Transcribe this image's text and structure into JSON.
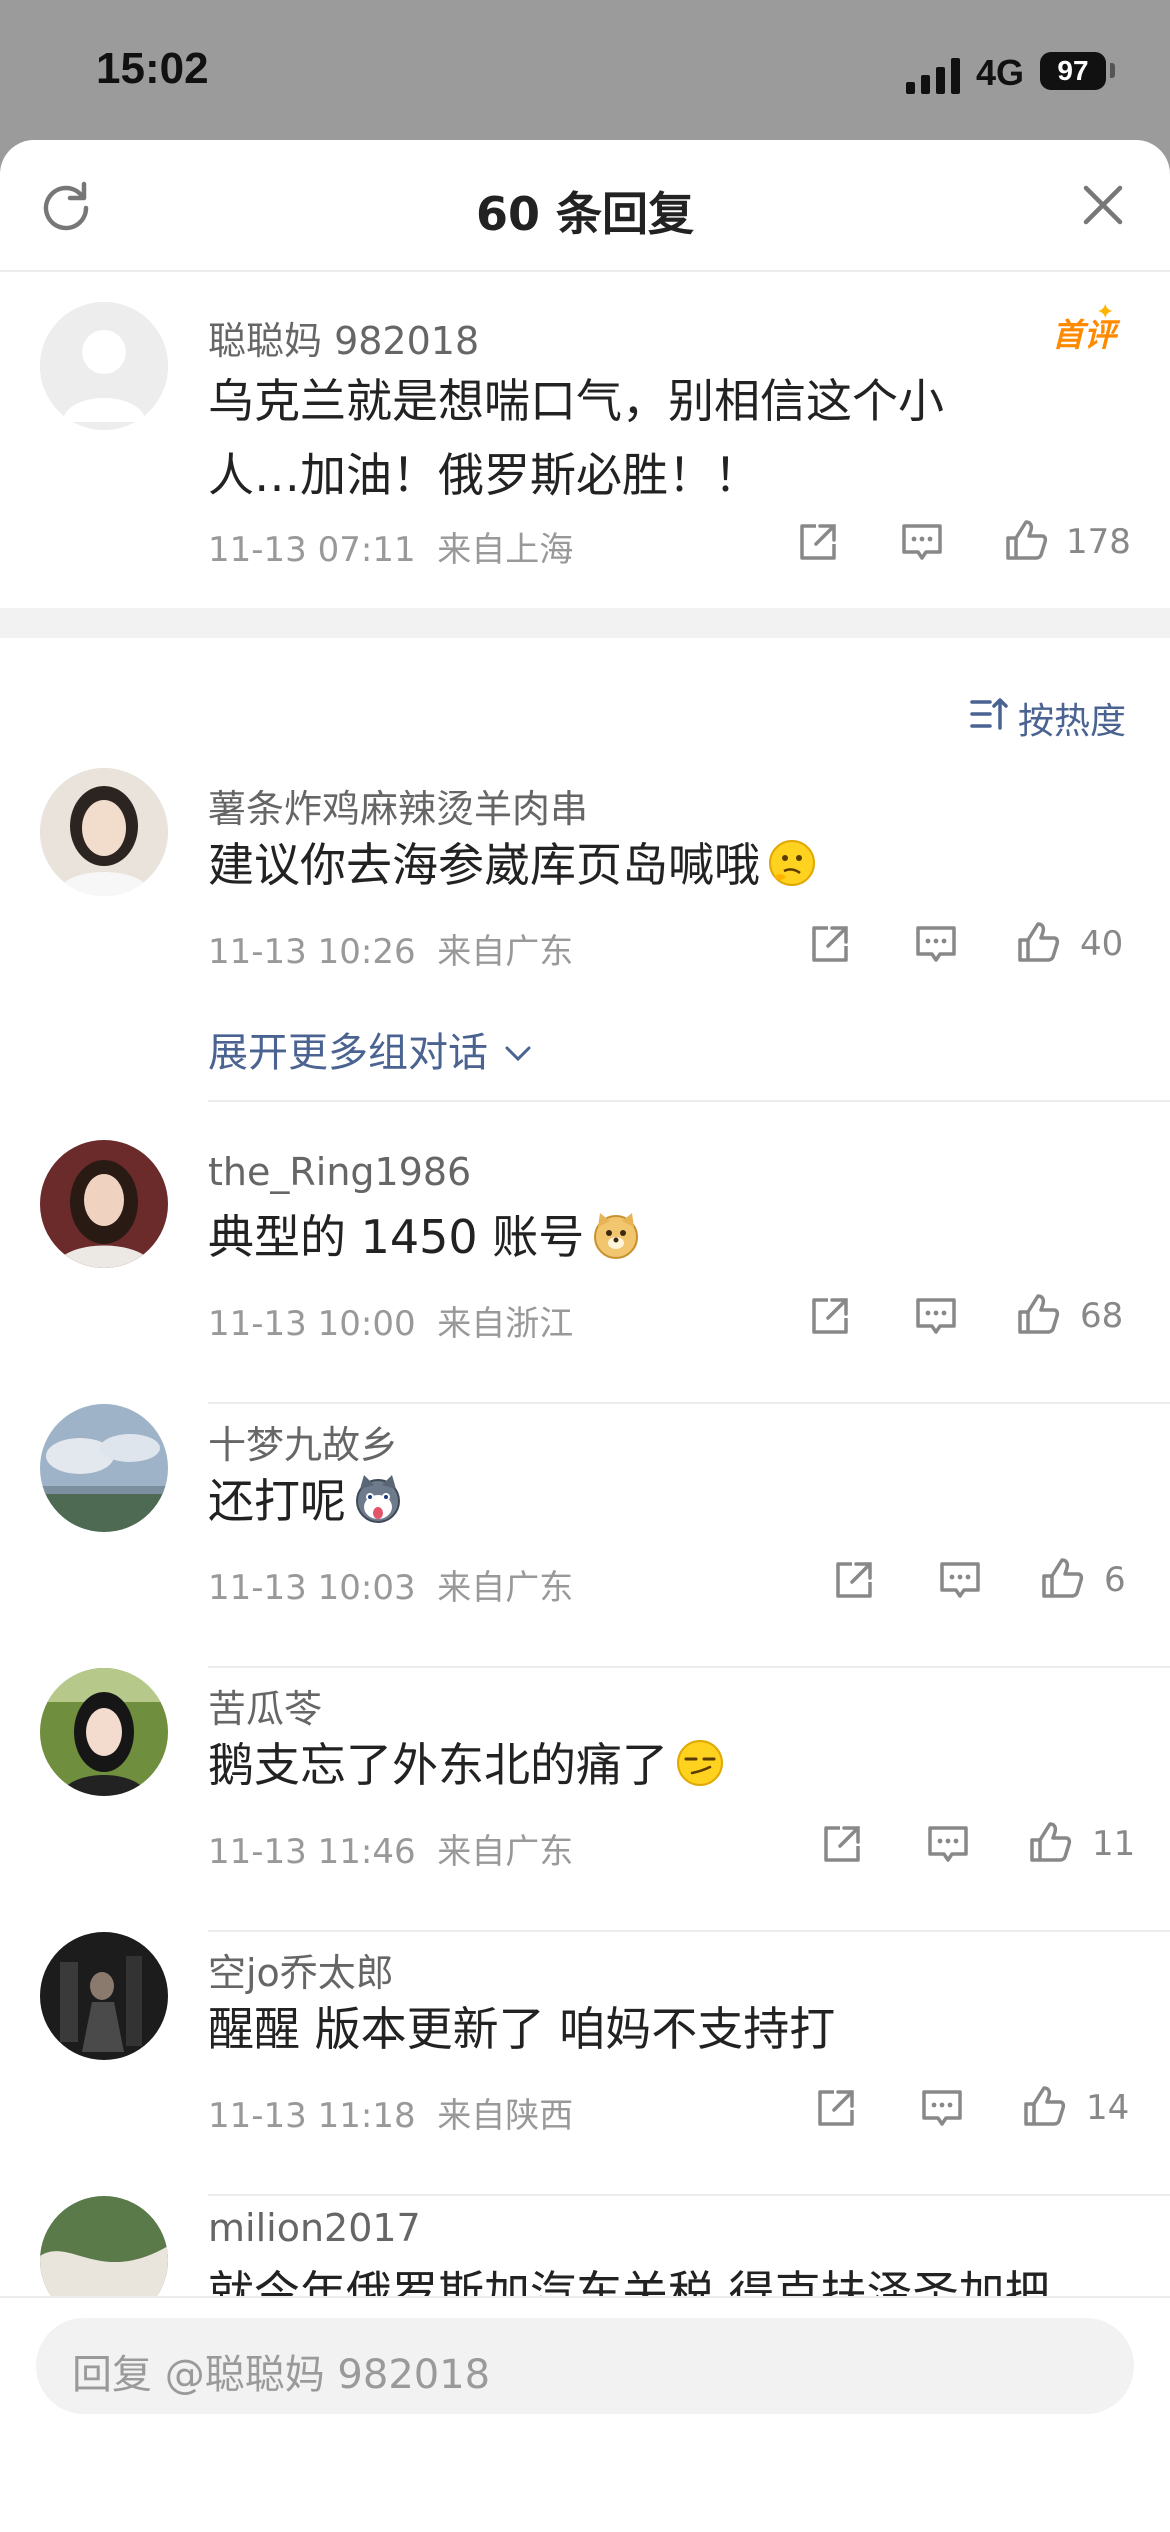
{
  "status_bar": {
    "time": "15:02",
    "network": "4G",
    "battery": "97"
  },
  "header": {
    "title": "60 条回复"
  },
  "root_comment": {
    "username": "聪聪妈 982018",
    "badge": "首评",
    "text_line1": "乌克兰就是想喘口气，别相信这个小",
    "text_line2": "人…加油！俄罗斯必胜！！",
    "time": "11-13 07:11",
    "location": "来自上海",
    "likes": "178"
  },
  "sort": {
    "label": "按热度"
  },
  "replies": [
    {
      "username": "薯条炸鸡麻辣烫羊肉串",
      "text": "建议你去海参崴库页岛喊哦",
      "emoji": "thinking-face",
      "time": "11-13 10:26",
      "location": "来自广东",
      "likes": "40",
      "expand_label": "展开更多组对话"
    },
    {
      "username": "the_Ring1986",
      "text": "典型的 1450 账号",
      "emoji": "doge",
      "time": "11-13 10:00",
      "location": "来自浙江",
      "likes": "68"
    },
    {
      "username": "十梦九故乡",
      "text": "还打呢",
      "emoji": "husky",
      "time": "11-13 10:03",
      "location": "来自广东",
      "likes": "6"
    },
    {
      "username": "苦瓜苓",
      "text": "鹅支忘了外东北的痛了",
      "emoji": "smirk-face",
      "time": "11-13 11:46",
      "location": "来自广东",
      "likes": "11"
    },
    {
      "username": "空jo乔太郎",
      "text": "醒醒 版本更新了 咱妈不支持打",
      "time": "11-13 11:18",
      "location": "来自陕西",
      "likes": "14"
    },
    {
      "username": "milion2017",
      "text": "就今年俄罗斯加汽车关税 得克扶泽圣加把"
    }
  ],
  "composer": {
    "placeholder": "回复 @聪聪妈 982018"
  },
  "colors": {
    "link": "#4a6391",
    "badge": "#ff8a00",
    "meta": "#999999"
  }
}
